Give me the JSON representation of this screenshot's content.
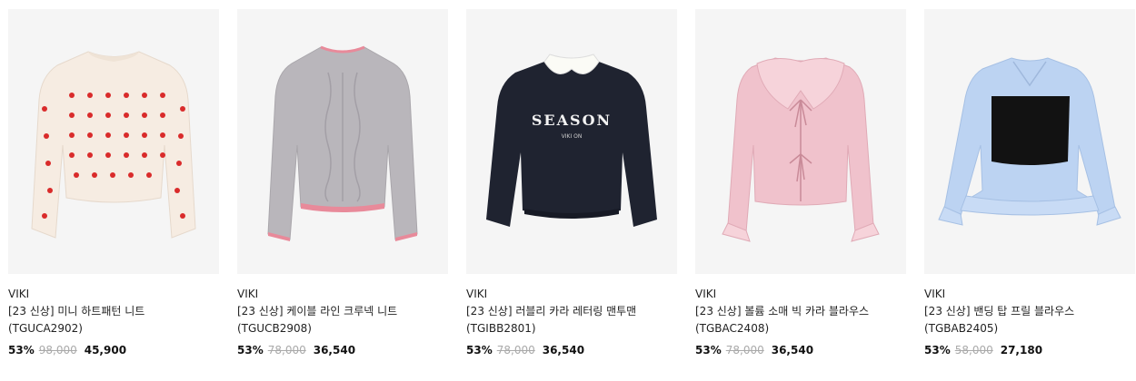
{
  "products": [
    {
      "brand": "VIKI",
      "title": "[23 신상] 미니 하트패턴 니트 (TGUCA2902)",
      "discount": "53%",
      "original_price": "98,000",
      "sale_price": "45,900",
      "image": "cream-heart-knit-sweater"
    },
    {
      "brand": "VIKI",
      "title": "[23 신상] 케이블 라인 크루넥 니트 (TGUCB2908)",
      "discount": "53%",
      "original_price": "78,000",
      "sale_price": "36,540",
      "image": "gray-cable-knit-sweater"
    },
    {
      "brand": "VIKI",
      "title": "[23 신상] 러블리 카라 레터링 맨투맨 (TGIBB2801)",
      "discount": "53%",
      "original_price": "78,000",
      "sale_price": "36,540",
      "image": "navy-collar-sweatshirt",
      "print": "SEASON",
      "print_sub": "VIKI ON"
    },
    {
      "brand": "VIKI",
      "title": "[23 신상] 볼륨 소매 빅 카라 블라우스 (TGBAC2408)",
      "discount": "53%",
      "original_price": "78,000",
      "sale_price": "36,540",
      "image": "pink-big-collar-blouse"
    },
    {
      "brand": "VIKI",
      "title": "[23 신상] 밴딩 탑 프릴 블라우스 (TGBAB2405)",
      "discount": "53%",
      "original_price": "58,000",
      "sale_price": "27,180",
      "image": "blue-frill-blouse-with-black-bustier"
    }
  ],
  "colors": {
    "thumb_bg": "#f5f5f5",
    "strike": "#aaaaaa",
    "text": "#111111"
  }
}
